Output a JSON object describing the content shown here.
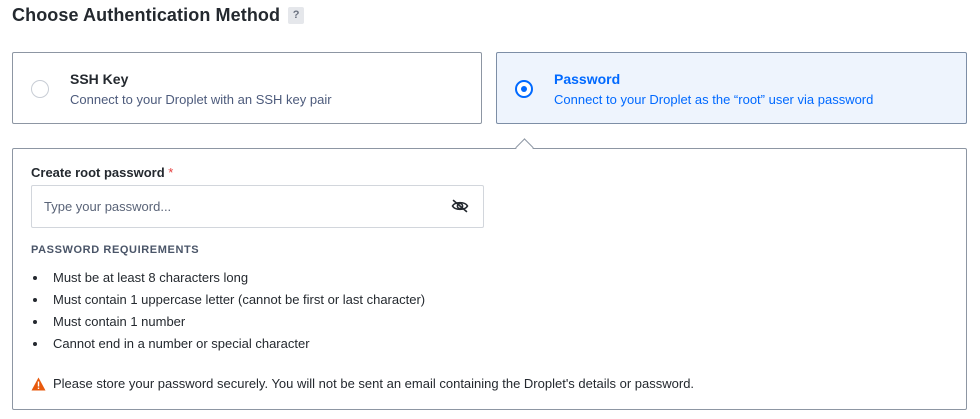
{
  "section": {
    "title": "Choose Authentication Method",
    "help_label": "?"
  },
  "options": [
    {
      "title": "SSH Key",
      "description": "Connect to your Droplet with an SSH key pair",
      "selected": false
    },
    {
      "title": "Password",
      "description": "Connect to your Droplet as the “root” user via password",
      "selected": true
    }
  ],
  "password_field": {
    "label": "Create root password",
    "required_marker": "*",
    "placeholder": "Type your password...",
    "value": ""
  },
  "requirements": {
    "heading": "PASSWORD REQUIREMENTS",
    "items": [
      "Must be at least 8 characters long",
      "Must contain 1 uppercase letter (cannot be first or last character)",
      "Must contain 1 number",
      "Cannot end in a number or special character"
    ]
  },
  "warning": {
    "icon": "warning-triangle-icon",
    "text": "Please store your password securely. You will not be sent an email containing the Droplet's details or password."
  },
  "colors": {
    "accent": "#0069ff",
    "selected_bg": "#eef4fd",
    "warning": "#e8590c",
    "required": "#e53e3e"
  }
}
